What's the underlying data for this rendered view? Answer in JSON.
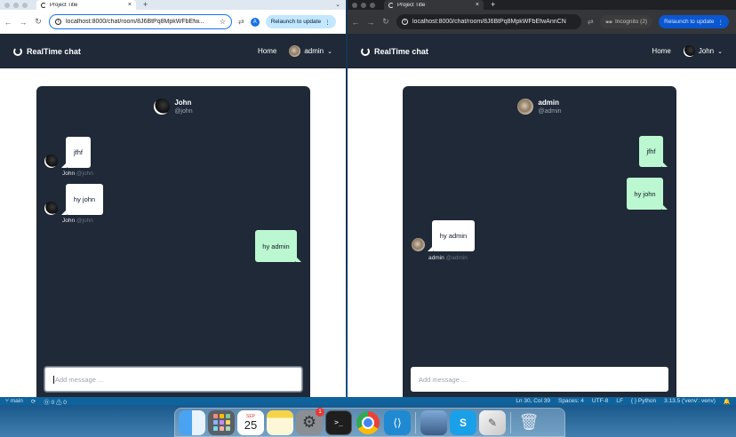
{
  "colors": {
    "app_header": "#1f2937",
    "chat_card": "#1f2937",
    "bubble_incoming": "#ffffff",
    "bubble_outgoing": "#bbf7d0",
    "statusbar": "#0e639c"
  },
  "left_window": {
    "tab": {
      "title": "Project Title",
      "close": "×"
    },
    "new_tab": "+",
    "url": "localhost:8000/chat/room/8J6BtPq8MpkWFbEfw...",
    "relaunch": "Relaunch to update",
    "profile_initial": "A",
    "app": {
      "logo": "RealTime chat",
      "nav_home": "Home",
      "user": "admin",
      "chat_header": {
        "name": "John",
        "handle": "@john"
      },
      "messages": [
        {
          "text": "jfhf",
          "author": "John",
          "handle": "@john",
          "direction": "incoming"
        },
        {
          "text": "hy john",
          "author": "John",
          "handle": "@john",
          "direction": "incoming"
        },
        {
          "text": "hy admin",
          "direction": "outgoing"
        }
      ],
      "composer_placeholder": "Add message ..."
    }
  },
  "right_window": {
    "tab": {
      "title": "Project Title",
      "close": "×"
    },
    "new_tab": "+",
    "url": "localhost:8000/chat/room/8J6BtPq8MpkWFbEfwAnnCN",
    "incognito": "Incognito (2)",
    "relaunch": "Relaunch to update",
    "app": {
      "logo": "RealTime chat",
      "nav_home": "Home",
      "user": "John",
      "chat_header": {
        "name": "admin",
        "handle": "@admin"
      },
      "messages": [
        {
          "text": "jfhf",
          "direction": "outgoing"
        },
        {
          "text": "hy john",
          "direction": "outgoing"
        },
        {
          "text": "hy admin",
          "author": "admin",
          "handle": "@admin",
          "direction": "incoming"
        }
      ],
      "composer_placeholder": "Add message ..."
    }
  },
  "statusbar": {
    "branch": "main",
    "problems": "⓪ 0 ⚠ 0",
    "cursor": "Ln 30, Col 39",
    "spaces": "Spaces: 4",
    "encoding": "UTF-8",
    "eol": "LF",
    "language": "Python",
    "interpreter": "3.13.5 ('venv': venv)"
  },
  "dock": {
    "calendar_month": "SEP",
    "calendar_day": "25",
    "settings_badge": "1",
    "terminal_glyph": ">_",
    "skype_glyph": "S"
  }
}
